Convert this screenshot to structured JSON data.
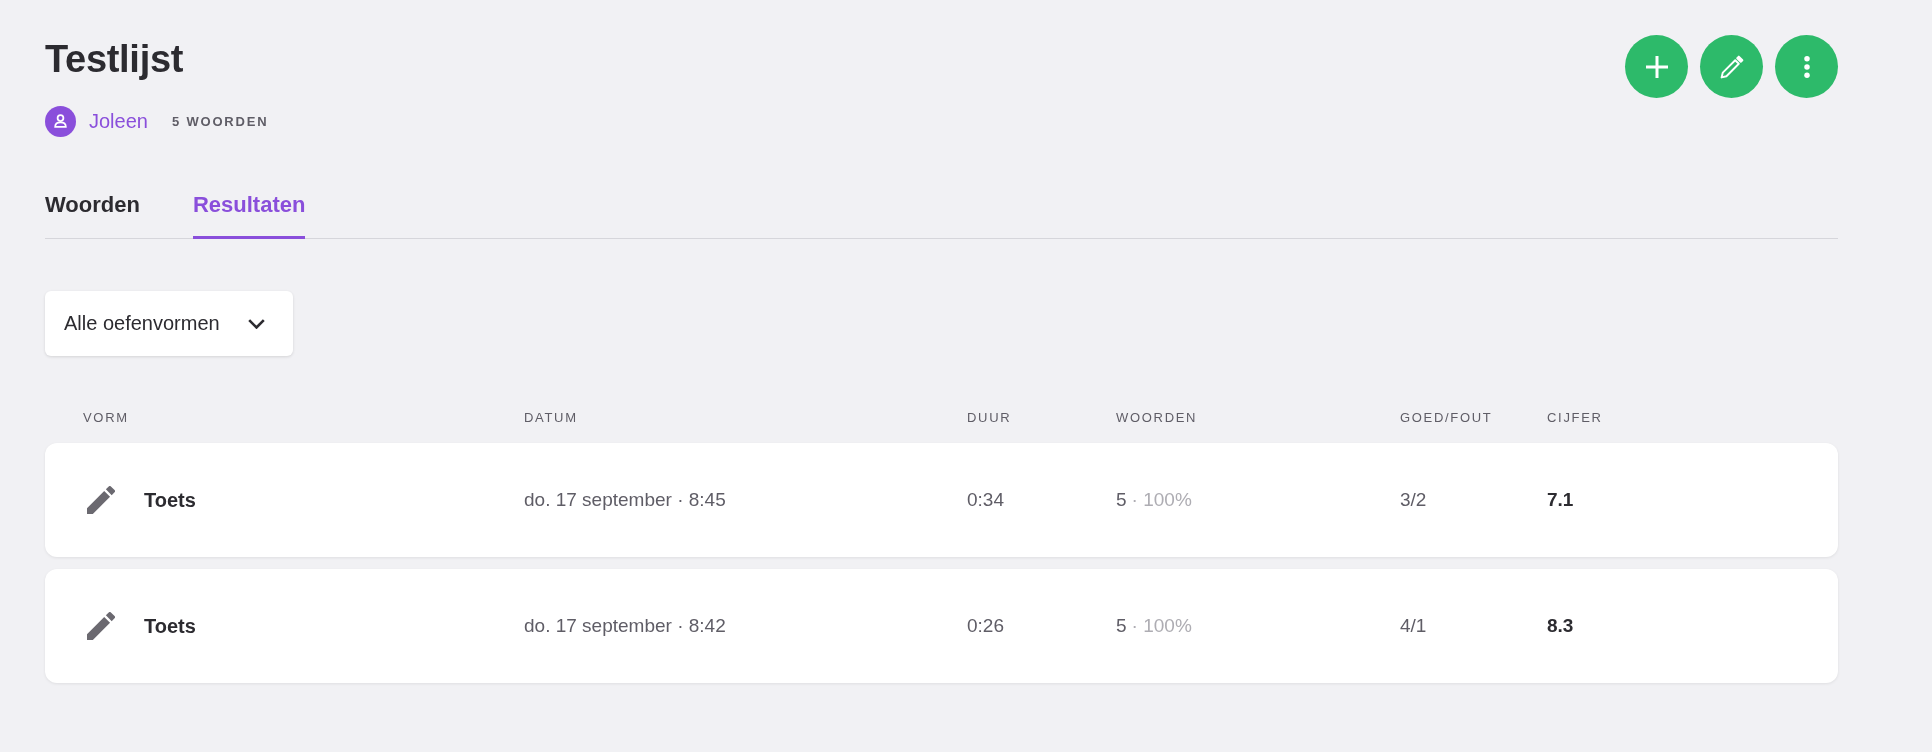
{
  "header": {
    "title": "Testlijst",
    "owner": {
      "name": "Joleen"
    },
    "word_count": "5 WOORDEN"
  },
  "actions": [
    {
      "kind": "add"
    },
    {
      "kind": "edit"
    },
    {
      "kind": "more"
    }
  ],
  "tabs": [
    {
      "label": "Woorden",
      "selected": false
    },
    {
      "label": "Resultaten",
      "selected": true
    }
  ],
  "filter": {
    "value": "Alle oefenvormen"
  },
  "table": {
    "columns": [
      "VORM",
      "DATUM",
      "DUUR",
      "WOORDEN",
      "GOED/FOUT",
      "CIJFER"
    ],
    "rows": [
      {
        "form": "Toets",
        "date": "do. 17 september · 8:45",
        "duration": "0:34",
        "words": "5",
        "share": "· 100%",
        "right_wrong": "3/2",
        "grade": "7.1"
      },
      {
        "form": "Toets",
        "date": "do. 17 september · 8:42",
        "duration": "0:26",
        "words": "5",
        "share": "· 100%",
        "right_wrong": "4/1",
        "grade": "8.3"
      }
    ]
  }
}
